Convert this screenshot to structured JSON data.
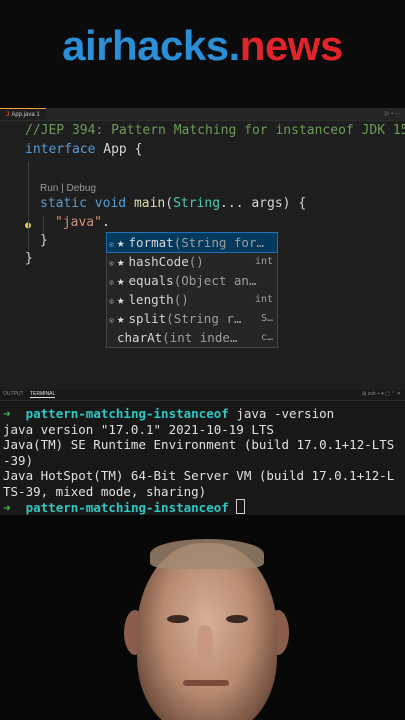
{
  "banner": {
    "logo_part1": "airhacks.",
    "logo_part2": "news"
  },
  "editor": {
    "tab": {
      "label": "App.java 1"
    },
    "tab_actions": "▷ ▫ ···",
    "code": {
      "line1": "//JEP 394: Pattern Matching for instanceof JDK 15",
      "line2_kw": "interface",
      "line2_rest": " App {",
      "codelens": "Run | Debug",
      "line4_kw1": "static",
      "line4_kw2": "void",
      "line4_fn": "main",
      "line4_type": "String",
      "line4_rest": "... args) {",
      "line5_str": "\"java\"",
      "line5_dot": ".",
      "line6": "}",
      "line7": "}"
    },
    "suggestions": [
      {
        "name": "format",
        "detail": "(String for…",
        "right": "",
        "selected": true
      },
      {
        "name": "hashCode",
        "detail": "()",
        "right": "int",
        "selected": false
      },
      {
        "name": "equals",
        "detail": "(Object an…",
        "right": "",
        "selected": false
      },
      {
        "name": "length",
        "detail": "()",
        "right": "int",
        "selected": false
      },
      {
        "name": "split",
        "detail": "(String r…",
        "right": "S…",
        "selected": false
      },
      {
        "name": "charAt",
        "detail": "(int inde…",
        "right": "c…",
        "selected": false
      }
    ]
  },
  "panel": {
    "tabs": {
      "output": "OUTPUT",
      "terminal": "TERMINAL"
    },
    "actions": "⊞ zsh + ▾ ▢ ⌃ ✕",
    "terminal": {
      "prompt_arrow": "➜",
      "dir": "pattern-matching-instanceof",
      "command": " java -version",
      "out1": "java version \"17.0.1\" 2021-10-19 LTS",
      "out2": "Java(TM) SE Runtime Environment (build 17.0.1+12-LTS",
      "out3": "-39)",
      "out4": "Java HotSpot(TM) 64-Bit Server VM (build 17.0.1+12-L",
      "out5": "TS-39, mixed mode, sharing)"
    }
  },
  "colors": {
    "brand_blue": "#2a8fd6",
    "brand_red": "#e1232a",
    "editor_bg": "#1e1e1e",
    "selection": "#04395e"
  }
}
